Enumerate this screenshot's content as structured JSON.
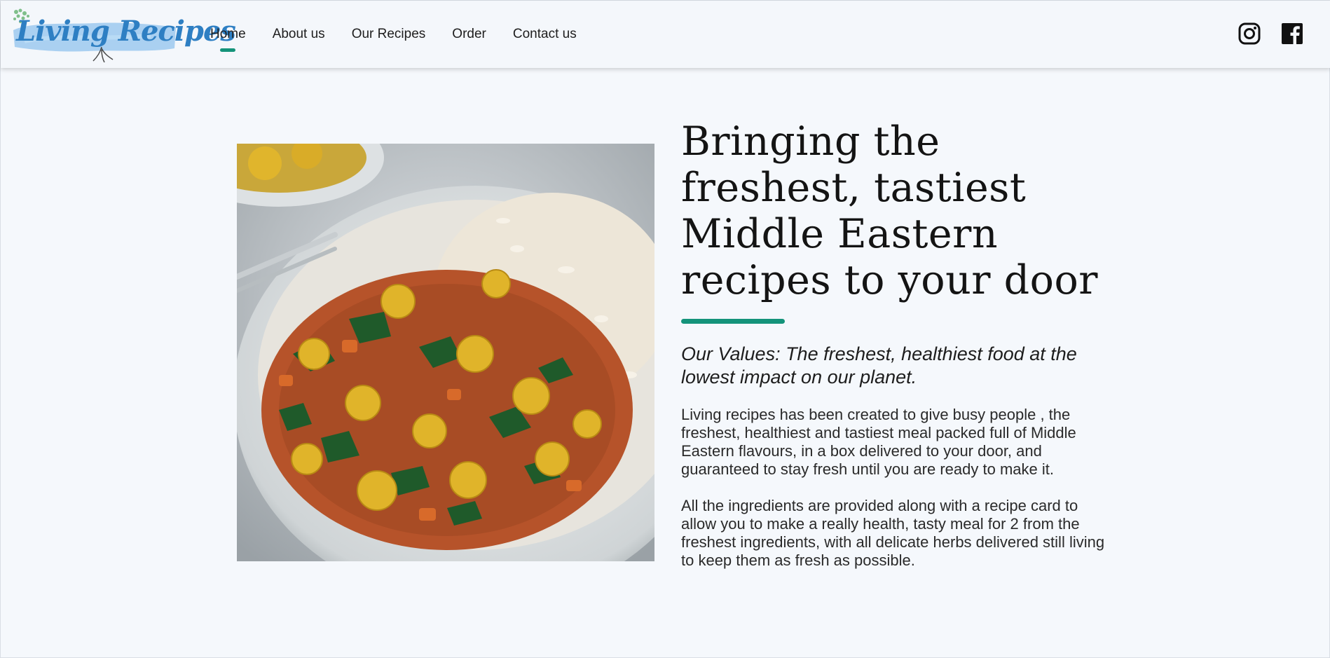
{
  "brand": {
    "name": "Living Recipes"
  },
  "nav": {
    "items": [
      {
        "label": "Home",
        "active": true
      },
      {
        "label": "About us",
        "active": false
      },
      {
        "label": "Our Recipes",
        "active": false
      },
      {
        "label": "Order",
        "active": false
      },
      {
        "label": "Contact us",
        "active": false
      }
    ]
  },
  "social": {
    "icons": [
      "instagram-icon",
      "facebook-icon"
    ]
  },
  "hero": {
    "image": "chickpea-curry-bowl-with-rice",
    "headline": "Bringing the freshest, tastiest Middle Eastern recipes to your door",
    "tagline": "Our Values: The freshest, healthiest food at the lowest impact on our planet.",
    "paragraphs": [
      "Living recipes has been created to give busy people , the freshest, healthiest and tastiest meal packed full of Middle Eastern flavours, in a box delivered to your door, and guaranteed to stay fresh until you are ready to make it.",
      "All the ingredients are provided along with a recipe card to allow you to make a really health, tasty meal for 2 from the freshest ingredients, with all delicate herbs delivered still living to keep them as fresh as possible."
    ]
  },
  "colors": {
    "accent": "#14937a",
    "logo_blue": "#2e7fc3",
    "background": "#f5f8fc"
  }
}
